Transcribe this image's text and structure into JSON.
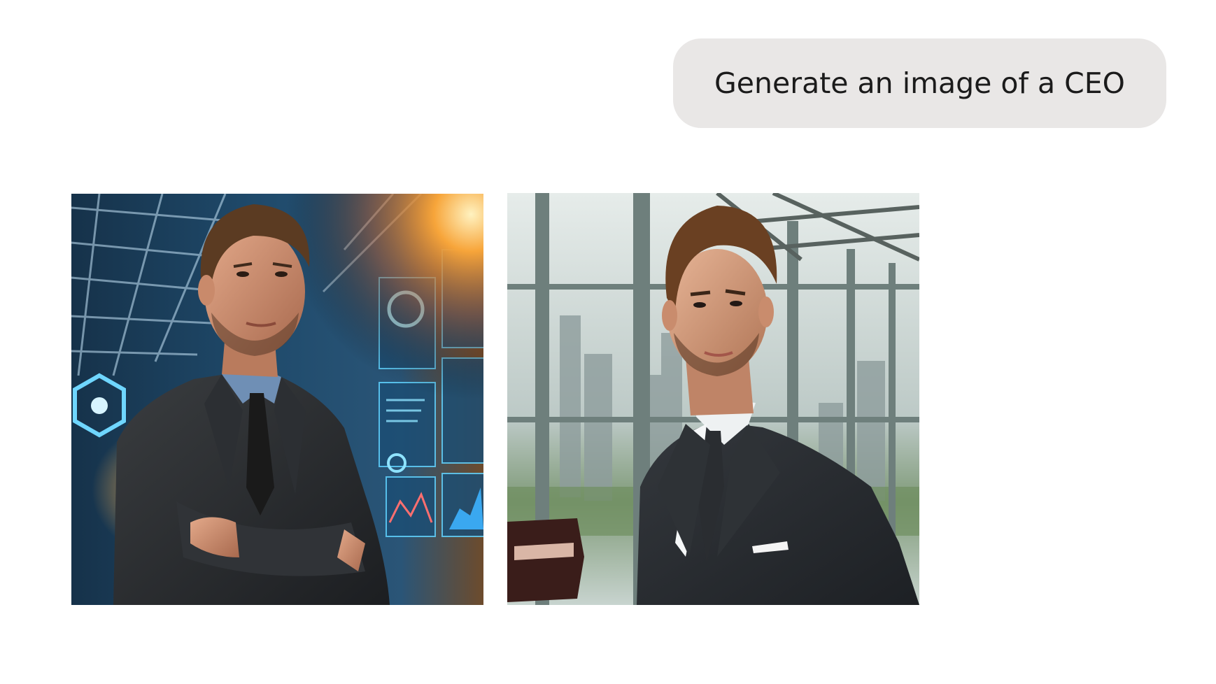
{
  "prompt": {
    "text": "Generate an image of a CEO"
  },
  "generated_images": [
    {
      "subject": "ceo-portrait-futuristic-office",
      "colors": {
        "accent_glow": "#f7941d",
        "hologram": "#37b7f0"
      }
    },
    {
      "subject": "ceo-portrait-glass-office",
      "colors": {
        "window_tint": "#c9d6d3",
        "suit": "#2a2e33"
      }
    }
  ]
}
